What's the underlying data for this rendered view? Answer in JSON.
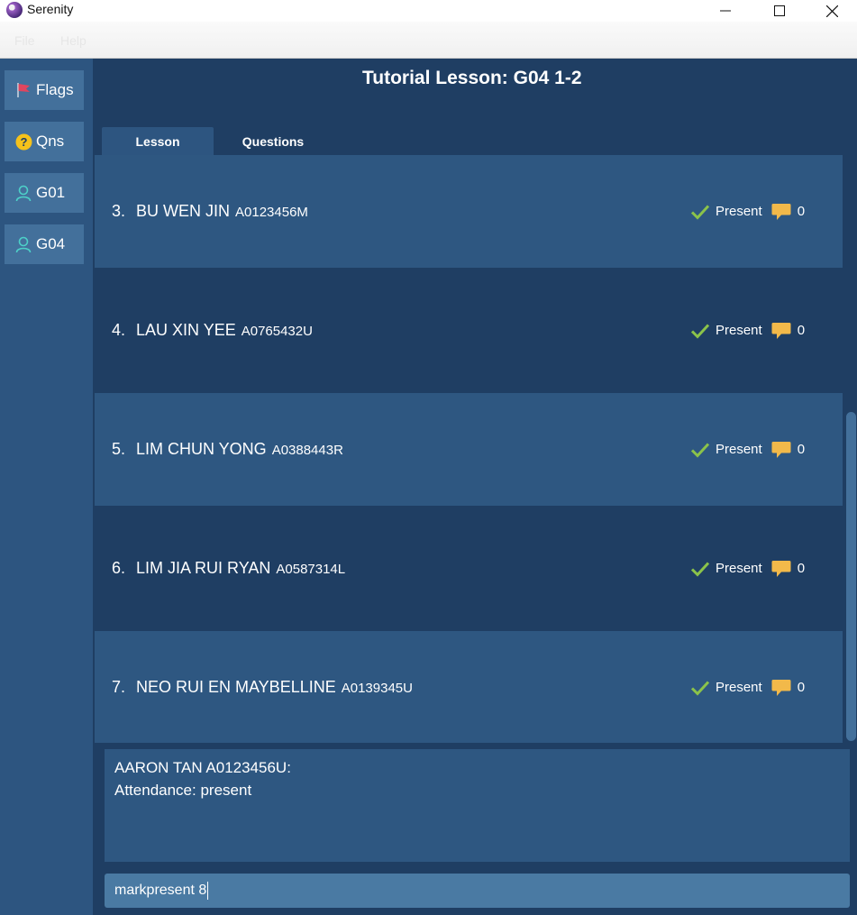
{
  "window": {
    "title": "Serenity"
  },
  "menubar": {
    "items": [
      "File",
      "Help"
    ]
  },
  "sidebar": {
    "items": [
      {
        "label": "Flags",
        "icon": "flag-icon"
      },
      {
        "label": "Qns",
        "icon": "question-icon"
      },
      {
        "label": "G01",
        "icon": "person-icon"
      },
      {
        "label": "G04",
        "icon": "person-icon"
      }
    ]
  },
  "main": {
    "title": "Tutorial Lesson: G04 1-2",
    "tabs": [
      {
        "label": "Lesson",
        "selected": true
      },
      {
        "label": "Questions",
        "selected": false
      }
    ],
    "students": [
      {
        "index": "3.",
        "name": "BU WEN JIN",
        "id": "A0123456M",
        "status": "Present",
        "comments": "0"
      },
      {
        "index": "4.",
        "name": "LAU XIN YEE",
        "id": "A0765432U",
        "status": "Present",
        "comments": "0"
      },
      {
        "index": "5.",
        "name": "LIM CHUN YONG",
        "id": "A0388443R",
        "status": "Present",
        "comments": "0"
      },
      {
        "index": "6.",
        "name": "LIM JIA RUI RYAN",
        "id": "A0587314L",
        "status": "Present",
        "comments": "0"
      },
      {
        "index": "7.",
        "name": "NEO RUI EN MAYBELLINE",
        "id": "A0139345U",
        "status": "Present",
        "comments": "0"
      }
    ],
    "result": {
      "line1": "AARON TAN A0123456U:",
      "line2": "Attendance: present"
    },
    "command": {
      "value": "markpresent 8"
    }
  },
  "colors": {
    "background": "#1f3e63",
    "row_alt": "#2e5781",
    "sidebar": "#2d5580",
    "button": "#43709b",
    "check": "#8bc34a",
    "comment": "#f2b94a",
    "flag": "#e0455e",
    "question": "#f5c21b",
    "person": "#4dd0c8"
  }
}
